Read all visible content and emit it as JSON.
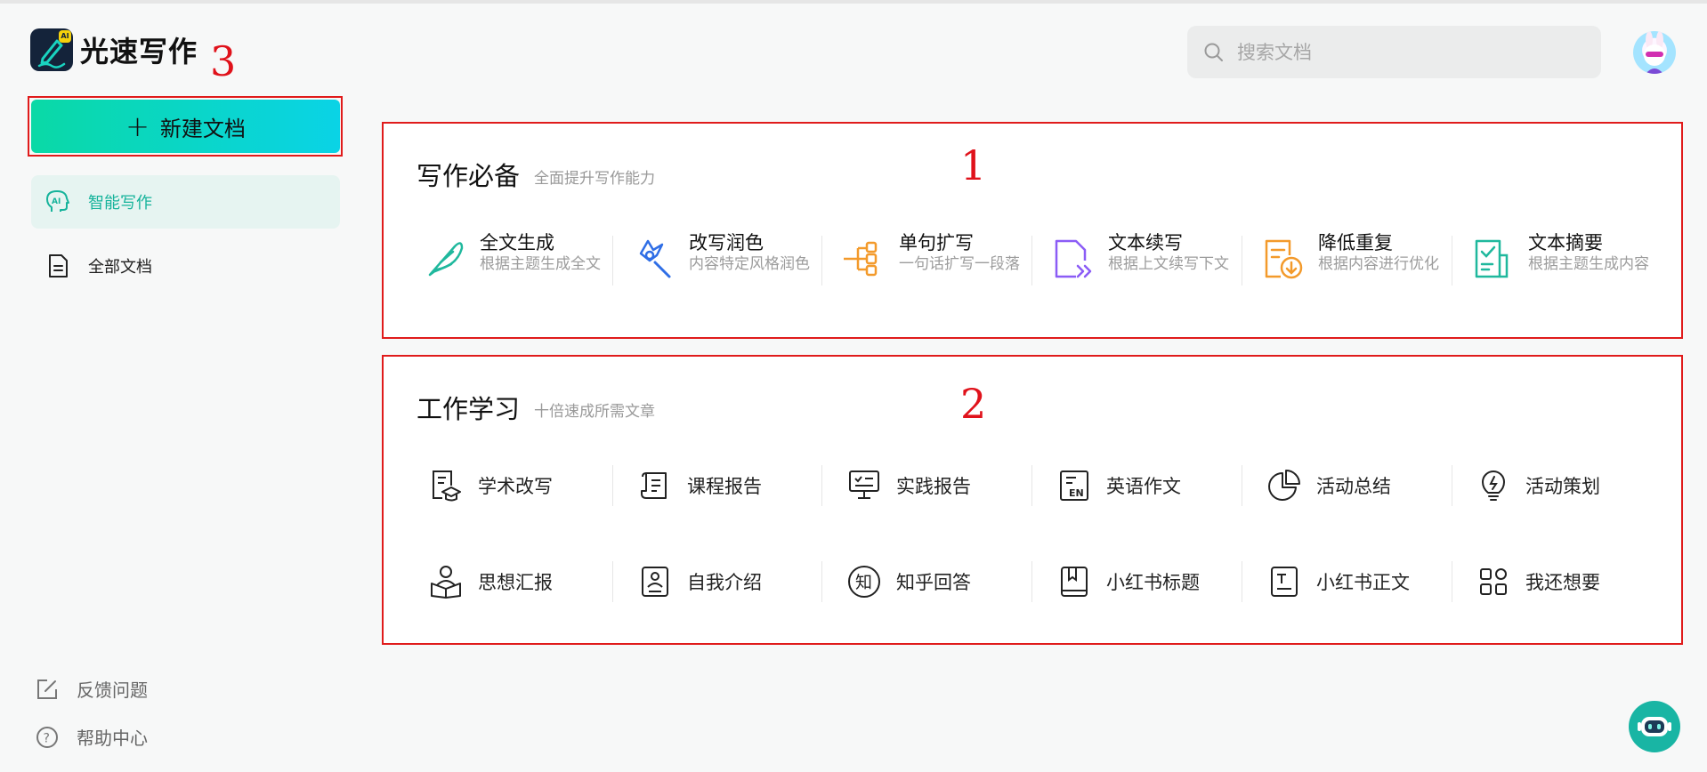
{
  "app": {
    "name": "光速写作",
    "logo_badge": "AI"
  },
  "annotations": {
    "a1": "1",
    "a2": "2",
    "a3": "3"
  },
  "sidebar": {
    "new_doc_label": "新建文档",
    "items": [
      {
        "label": "智能写作",
        "icon": "ai-head-icon",
        "active": true
      },
      {
        "label": "全部文档",
        "icon": "document-icon",
        "active": false
      }
    ],
    "bottom": [
      {
        "label": "反馈问题",
        "icon": "edit-square-icon"
      },
      {
        "label": "帮助中心",
        "icon": "help-circle-icon"
      }
    ]
  },
  "search": {
    "placeholder": "搜索文档"
  },
  "writing_essentials": {
    "title": "写作必备",
    "subtitle": "全面提升写作能力",
    "features": [
      {
        "name": "全文生成",
        "desc": "根据主题生成全文",
        "icon": "feather-icon",
        "color": "#1fb89d"
      },
      {
        "name": "改写润色",
        "desc": "内容特定风格润色",
        "icon": "magic-wand-icon",
        "color": "#2f6ee6"
      },
      {
        "name": "单句扩写",
        "desc": "一句话扩写一段落",
        "icon": "branch-expand-icon",
        "color": "#f39a2b"
      },
      {
        "name": "文本续写",
        "desc": "根据上文续写下文",
        "icon": "continue-file-icon",
        "color": "#8b5cf6"
      },
      {
        "name": "降低重复",
        "desc": "根据内容进行优化",
        "icon": "reduce-repeat-icon",
        "color": "#f39a2b"
      },
      {
        "name": "文本摘要",
        "desc": "根据主题生成内容",
        "icon": "summary-check-icon",
        "color": "#1fb89d"
      }
    ]
  },
  "work_study": {
    "title": "工作学习",
    "subtitle": "十倍速成所需文章",
    "tools": [
      {
        "name": "学术改写",
        "icon": "academic-icon"
      },
      {
        "name": "课程报告",
        "icon": "scroll-icon"
      },
      {
        "name": "实践报告",
        "icon": "board-report-icon"
      },
      {
        "name": "英语作文",
        "icon": "english-doc-icon"
      },
      {
        "name": "活动总结",
        "icon": "pie-chart-icon"
      },
      {
        "name": "活动策划",
        "icon": "lightbulb-icon"
      },
      {
        "name": "思想汇报",
        "icon": "reading-person-icon"
      },
      {
        "name": "自我介绍",
        "icon": "profile-doc-icon"
      },
      {
        "name": "知乎回答",
        "icon": "zhihu-icon",
        "glyph": "知"
      },
      {
        "name": "小红书标题",
        "icon": "bookmark-doc-icon"
      },
      {
        "name": "小红书正文",
        "icon": "text-doc-icon"
      },
      {
        "name": "我还想要",
        "icon": "grid-apps-icon"
      }
    ]
  }
}
